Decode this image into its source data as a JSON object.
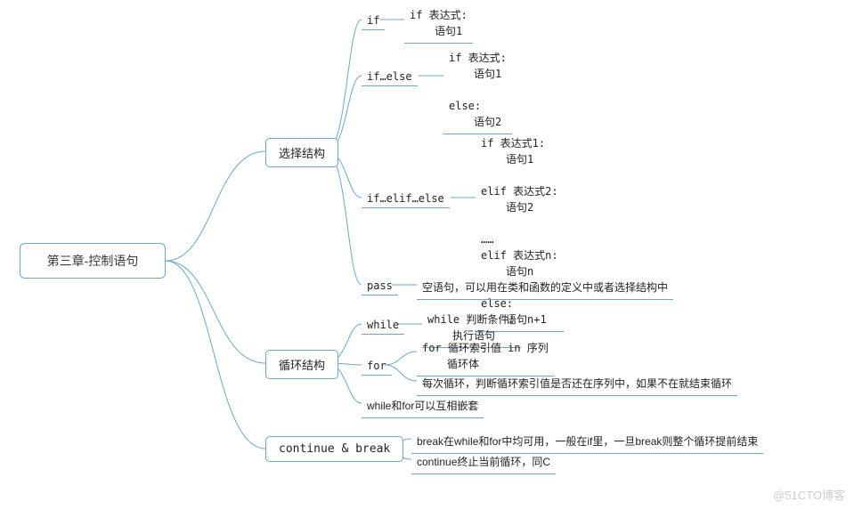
{
  "watermark": "@51CTO博客",
  "root": {
    "title": "第三章-控制语句"
  },
  "selection": {
    "title": "选择结构",
    "if": {
      "label": "if",
      "code_line1": "if 表达式:",
      "code_line2": "语句1"
    },
    "if_else": {
      "label": "if…else",
      "code_line1": "if 表达式:",
      "code_line2": "语句1",
      "code_line3": "else:",
      "code_line4": "语句2"
    },
    "if_elif_else": {
      "label": "if…elif…else",
      "code_line1": "if 表达式1:",
      "code_line2": "语句1",
      "code_line3": "elif 表达式2:",
      "code_line4": "语句2",
      "code_line5": "……",
      "code_line6": "elif 表达式n:",
      "code_line7": "语句n",
      "code_line8": "else:",
      "code_line9": "语句n+1"
    },
    "pass": {
      "label": "pass",
      "text": "空语句，可以用在类和函数的定义中或者选择结构中"
    }
  },
  "loop": {
    "title": "循环结构",
    "while": {
      "label": "while",
      "code_line1": "while 判断条件:",
      "code_line2": "执行语句"
    },
    "for": {
      "label": "for",
      "code_line1": "for 循环索引值 in 序列",
      "code_line2": "循环体",
      "note": "每次循环，判断循环索引值是否还在序列中，如果不在就结束循环"
    },
    "nest": {
      "text": "while和for可以互相嵌套"
    }
  },
  "cb": {
    "title": "continue & break",
    "break_text": "break在while和for中均可用，一般在if里，一旦break则整个循环提前结束",
    "continue_text": "continue终止当前循环，同C"
  }
}
